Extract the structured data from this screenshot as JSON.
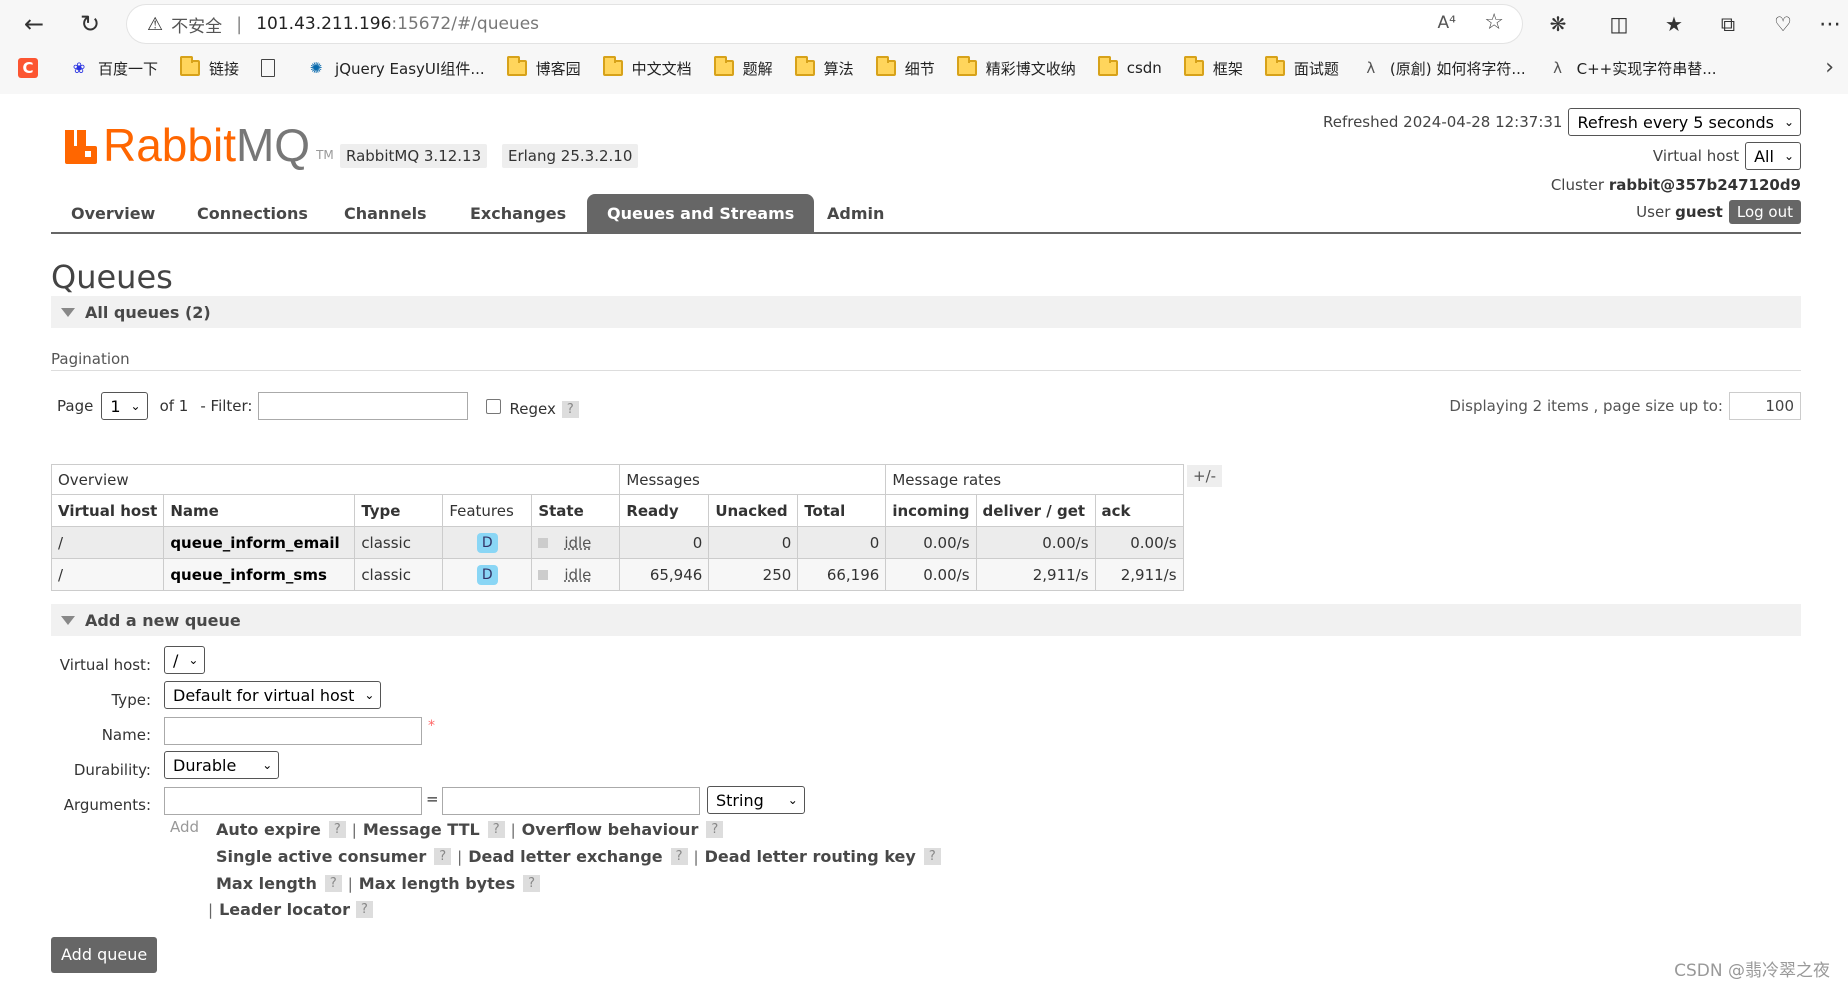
{
  "browser": {
    "insecure_label": "不安全",
    "url_host": "101.43.211.196",
    "url_rest": ":15672/#/queues",
    "read_aloud": "A⁴",
    "bookmarks": [
      {
        "label": "百度一下",
        "icon": "baidu-icon"
      },
      {
        "label": "链接",
        "icon": "folder-icon"
      },
      {
        "label": "",
        "icon": "page-icon"
      },
      {
        "label": "jQuery EasyUI组件...",
        "icon": "jquery-icon"
      },
      {
        "label": "博客园",
        "icon": "folder-icon"
      },
      {
        "label": "中文文档",
        "icon": "folder-icon"
      },
      {
        "label": "题解",
        "icon": "folder-icon"
      },
      {
        "label": "算法",
        "icon": "folder-icon"
      },
      {
        "label": "细节",
        "icon": "folder-icon"
      },
      {
        "label": "精彩博文收纳",
        "icon": "folder-icon"
      },
      {
        "label": "csdn",
        "icon": "folder-icon"
      },
      {
        "label": "框架",
        "icon": "folder-icon"
      },
      {
        "label": "面试题",
        "icon": "folder-icon"
      },
      {
        "label": "(原創) 如何将字符...",
        "icon": "site-icon"
      },
      {
        "label": "C++实现字符串替...",
        "icon": "site-icon"
      }
    ]
  },
  "header": {
    "logo_rabbit": "Rabbit",
    "logo_mq": "MQ",
    "logo_tm": "TM",
    "rabbitmq_version": "RabbitMQ 3.12.13",
    "erlang_version": "Erlang 25.3.2.10",
    "refreshed_label": "Refreshed 2024-04-28 12:37:31",
    "refresh_select": "Refresh every 5 seconds",
    "virtual_host_label": "Virtual host",
    "virtual_host_value": "All",
    "cluster_label": "Cluster",
    "cluster_value": "rabbit@357b247120d9",
    "user_label": "User",
    "user_value": "guest",
    "logout": "Log out"
  },
  "tabs": [
    {
      "label": "Overview"
    },
    {
      "label": "Connections"
    },
    {
      "label": "Channels"
    },
    {
      "label": "Exchanges"
    },
    {
      "label": "Queues and Streams",
      "active": true
    },
    {
      "label": "Admin"
    }
  ],
  "main": {
    "title": "Queues",
    "all_queues": "All queues (2)",
    "pagination_label": "Pagination",
    "page_label": "Page",
    "page_value": "1",
    "of_label": "of 1",
    "filter_label": "- Filter:",
    "filter_value": "",
    "regex_label": "Regex",
    "help": "?",
    "display_info": "Displaying 2 items , page size up to:",
    "page_size": "100",
    "plus_minus": "+/-"
  },
  "table": {
    "groups": [
      "Overview",
      "Messages",
      "Message rates"
    ],
    "columns": [
      "Virtual host",
      "Name",
      "Type",
      "Features",
      "State",
      "Ready",
      "Unacked",
      "Total",
      "incoming",
      "deliver / get",
      "ack"
    ],
    "rows": [
      {
        "vhost": "/",
        "name": "queue_inform_email",
        "type": "classic",
        "feature": "D",
        "state": "idle",
        "ready": "0",
        "unacked": "0",
        "total": "0",
        "incoming": "0.00/s",
        "deliver": "0.00/s",
        "ack": "0.00/s"
      },
      {
        "vhost": "/",
        "name": "queue_inform_sms",
        "type": "classic",
        "feature": "D",
        "state": "idle",
        "ready": "65,946",
        "unacked": "250",
        "total": "66,196",
        "incoming": "0.00/s",
        "deliver": "2,911/s",
        "ack": "2,911/s"
      }
    ]
  },
  "add_queue": {
    "heading": "Add a new queue",
    "virtual_host_label": "Virtual host:",
    "virtual_host_value": "/",
    "type_label": "Type:",
    "type_value": "Default for virtual host",
    "name_label": "Name:",
    "name_value": "",
    "required_mark": "*",
    "durability_label": "Durability:",
    "durability_value": "Durable",
    "arguments_label": "Arguments:",
    "equals": "=",
    "arg_type": "String",
    "add_label": "Add",
    "arg_links_row1": [
      "Auto expire",
      "Message TTL",
      "Overflow behaviour"
    ],
    "arg_links_row2": [
      "Single active consumer",
      "Dead letter exchange",
      "Dead letter routing key"
    ],
    "arg_links_row3": [
      "Max length",
      "Max length bytes"
    ],
    "arg_links_row4": [
      "Leader locator"
    ],
    "pipe": "|",
    "submit": "Add queue"
  },
  "watermark": "CSDN @翡冷翠之夜"
}
